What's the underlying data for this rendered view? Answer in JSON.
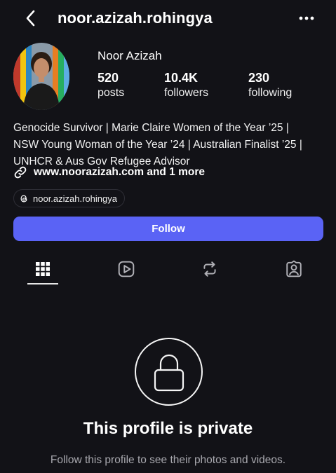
{
  "header": {
    "username": "noor.azizah.rohingya",
    "back_icon": "chevron-left-icon",
    "more_icon": "more-horizontal-icon"
  },
  "profile": {
    "display_name": "Noor Azizah",
    "stats": {
      "posts": {
        "value": "520",
        "label": "posts"
      },
      "followers": {
        "value": "10.4K",
        "label": "followers"
      },
      "following": {
        "value": "230",
        "label": "following"
      }
    },
    "bio_lines": [
      "Genocide Survivor | Marie Claire Women of the Year ’25 |",
      "NSW Young Woman of the Year ’24 | Australian Finalist ’25 |",
      "UNHCR & Aus Gov Refugee Advisor"
    ],
    "link_text": "www.noorazizah.com and 1 more",
    "threads_handle": "noor.azizah.rohingya",
    "follow_label": "Follow"
  },
  "tabs": [
    {
      "icon": "grid-icon",
      "active": true
    },
    {
      "icon": "reels-icon",
      "active": false
    },
    {
      "icon": "repost-icon",
      "active": false
    },
    {
      "icon": "tagged-icon",
      "active": false
    }
  ],
  "private_notice": {
    "title": "This profile is private",
    "subtitle": "Follow this profile to see their photos and videos."
  },
  "colors": {
    "background": "#121217",
    "follow_button": "#5a63f5",
    "secondary_text": "#a8a8ae"
  }
}
